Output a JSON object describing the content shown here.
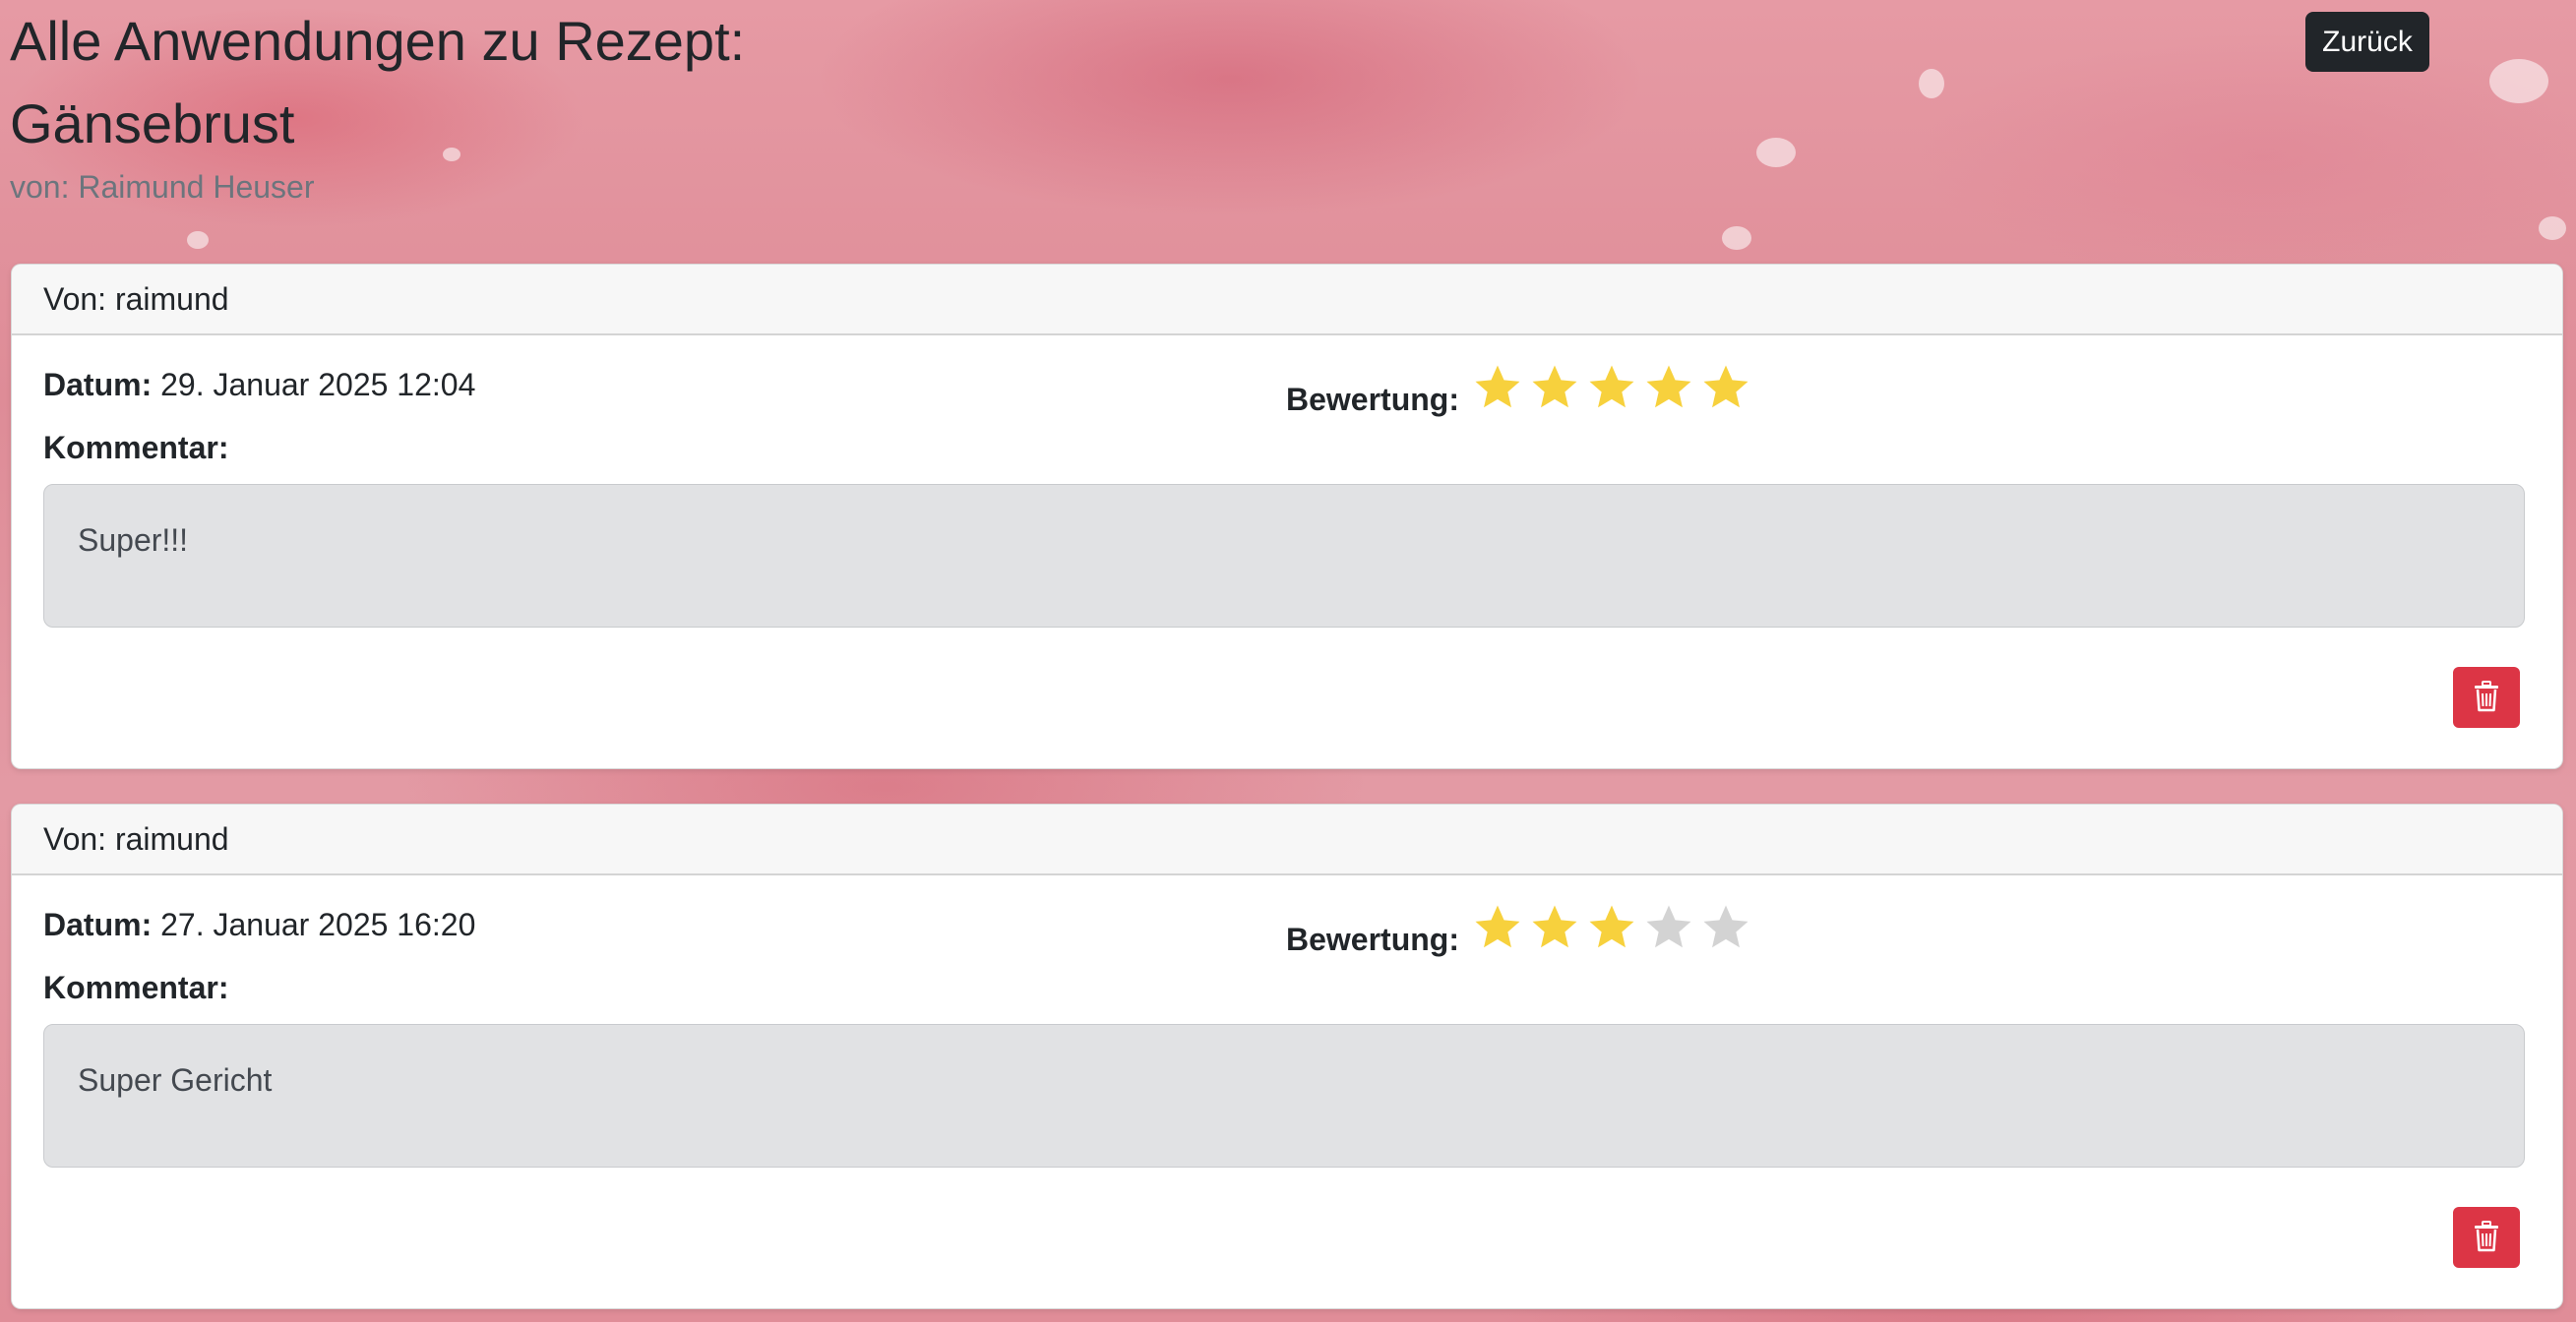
{
  "page": {
    "title_line1": "Alle Anwendungen zu Rezept:",
    "title_line2": "Gänsebrust",
    "author": "von: Raimund Heuser",
    "back_label": "Zurück"
  },
  "labels": {
    "date": "Datum:",
    "comment": "Kommentar:",
    "rating": "Bewertung:"
  },
  "colors": {
    "star_filled": "#f7d13d",
    "star_empty": "#d3d3d3",
    "delete_button": "#dc3545",
    "back_button": "#212529"
  },
  "reviews": [
    {
      "header": "Von: raimund",
      "date": "29. Januar 2025 12:04",
      "rating": 5,
      "rating_max": 5,
      "comment": "Super!!!",
      "delete_icon": "trash-icon"
    },
    {
      "header": "Von: raimund",
      "date": "27. Januar 2025 16:20",
      "rating": 3,
      "rating_max": 5,
      "comment": "Super Gericht",
      "delete_icon": "trash-icon"
    }
  ]
}
